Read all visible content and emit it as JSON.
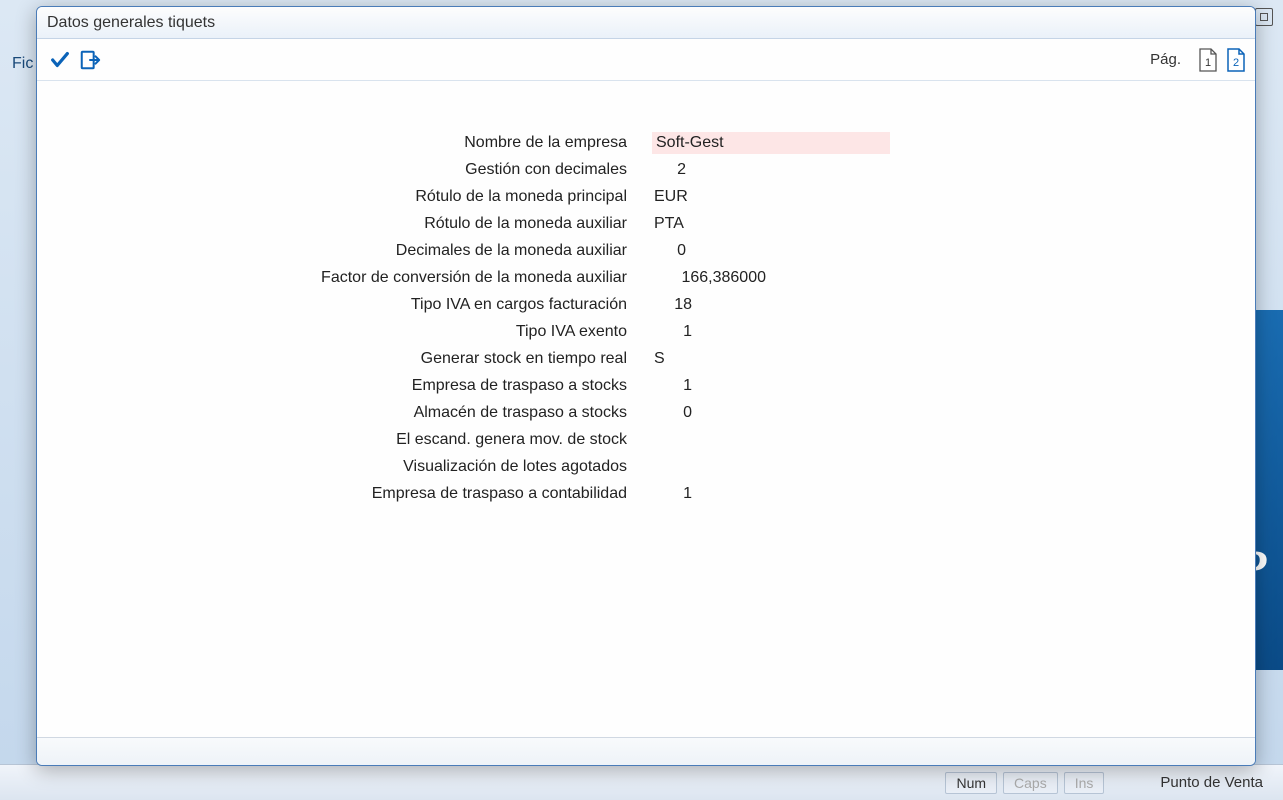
{
  "dialog": {
    "title": "Datos generales tiquets",
    "pag_label": "Pág.",
    "page1": "1",
    "page2": "2"
  },
  "form": {
    "rows": [
      {
        "label": "Nombre de la empresa",
        "value": "Soft-Gest",
        "style": "highlight"
      },
      {
        "label": "Gestión con decimales",
        "value": "2",
        "style": "short"
      },
      {
        "label": "Rótulo de la moneda principal",
        "value": "EUR",
        "style": "medium"
      },
      {
        "label": "Rótulo de la moneda auxiliar",
        "value": "PTA",
        "style": "medium"
      },
      {
        "label": "Decimales de la moneda auxiliar",
        "value": "0",
        "style": "short"
      },
      {
        "label": "Factor de conversión de la moneda auxiliar",
        "value": "166,386000",
        "style": "wide-num"
      },
      {
        "label": "Tipo IVA en cargos facturación",
        "value": "18",
        "style": "num"
      },
      {
        "label": "Tipo IVA exento",
        "value": "1",
        "style": "num"
      },
      {
        "label": "Generar stock en tiempo real",
        "value": "S",
        "style": "letter"
      },
      {
        "label": "Empresa de traspaso a stocks",
        "value": "1",
        "style": "num"
      },
      {
        "label": "Almacén de traspaso a stocks",
        "value": "0",
        "style": "num"
      },
      {
        "label": "El escand. genera mov. de stock",
        "value": "",
        "style": "tiny"
      },
      {
        "label": "Visualización de lotes agotados",
        "value": "",
        "style": "tiny"
      },
      {
        "label": "Empresa de traspaso a contabilidad",
        "value": "1",
        "style": "num"
      }
    ]
  },
  "background": {
    "menu_item": "Fic",
    "status": {
      "num": "Num",
      "caps": "Caps",
      "ins": "Ins",
      "right": "Punto de Venta"
    }
  }
}
